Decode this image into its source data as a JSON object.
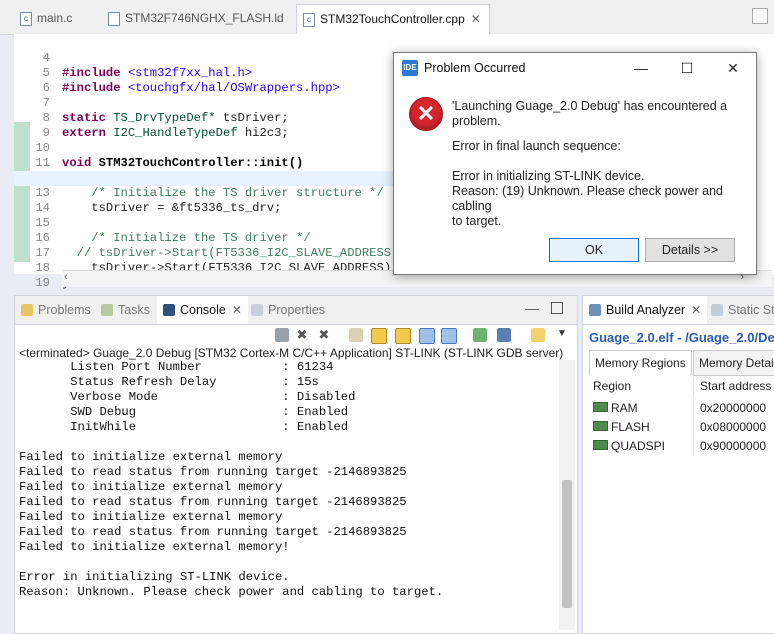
{
  "editor": {
    "tabs": [
      {
        "label": "main.c"
      },
      {
        "label": "STM32F746NGHX_FLASH.ld"
      },
      {
        "label": "STM32TouchController.cpp"
      }
    ],
    "lines": [
      {
        "n": "4"
      },
      {
        "n": "5"
      },
      {
        "n": "6"
      },
      {
        "n": "7"
      },
      {
        "n": "8"
      },
      {
        "n": "9"
      },
      {
        "n": "10"
      },
      {
        "n": "11"
      },
      {
        "n": "12"
      },
      {
        "n": "13"
      },
      {
        "n": "14"
      },
      {
        "n": "15"
      },
      {
        "n": "16"
      },
      {
        "n": "17"
      },
      {
        "n": "18"
      },
      {
        "n": "19"
      }
    ],
    "code": {
      "l4_kw": "#include",
      "l4_rest": " <stm32f7xx_hal.h>",
      "l5_kw": "#include",
      "l5_rest": " <touchgfx/hal/OSWrappers.hpp>",
      "l7_kw": "static",
      "l7_ty": " TS_DrvTypeDef*",
      "l7_rest": " tsDriver;",
      "l8_kw": "extern",
      "l8_ty": " I2C_HandleTypeDef",
      "l8_rest": " hi2c3;",
      "l10_kw": "void",
      "l10_fn": " STM32TouchController::init()",
      "l11": "{",
      "l12": "    /* Initialize the TS driver structure */",
      "l13_a": "    tsDriver = ",
      "l13_b": "&ft5336_ts_drv;",
      "l15": "    /* Initialize the TS driver */",
      "l16": "  // tsDriver->Start(FT5336_I2C_SLAVE_ADDRESS)",
      "l17_a": "    tsDriver->",
      "l17_b": "Start",
      "l17_c": "(FT5336_I2C_SLAVE_ADDRESS);",
      "l18": "}"
    }
  },
  "console": {
    "tabs": [
      {
        "label": "Problems"
      },
      {
        "label": "Tasks"
      },
      {
        "label": "Console"
      },
      {
        "label": "Properties"
      }
    ],
    "header": "<terminated> Guage_2.0 Debug [STM32 Cortex-M C/C++ Application] ST-LINK (ST-LINK GDB server)",
    "output": [
      "       Listen Port Number           : 61234",
      "       Status Refresh Delay         : 15s",
      "       Verbose Mode                 : Disabled",
      "       SWD Debug                    : Enabled",
      "       InitWhile                    : Enabled",
      "",
      "Failed to initialize external memory",
      "Failed to read status from running target -2146893825",
      "Failed to initialize external memory",
      "Failed to read status from running target -2146893825",
      "Failed to initialize external memory",
      "Failed to read status from running target -2146893825",
      "Failed to initialize external memory!",
      "",
      "Error in initializing ST-LINK device.",
      "Reason: Unknown. Please check power and cabling to target."
    ]
  },
  "build": {
    "tabs": [
      {
        "label": "Build Analyzer"
      },
      {
        "label": "Static Sta"
      }
    ],
    "title": "Guage_2.0.elf - /Guage_2.0/De",
    "subtabs": [
      {
        "label": "Memory Regions"
      },
      {
        "label": "Memory Detai"
      }
    ],
    "columns": {
      "region": "Region",
      "start": "Start address"
    },
    "regions": [
      {
        "name": "RAM",
        "start": "0x20000000"
      },
      {
        "name": "FLASH",
        "start": "0x08000000"
      },
      {
        "name": "QUADSPI",
        "start": "0x90000000"
      }
    ]
  },
  "dialog": {
    "icon_label": "IDE",
    "title": "Problem Occurred",
    "message_line1": "'Launching Guage_2.0 Debug' has encountered a",
    "message_line2": "problem.",
    "detail_line1": "Error in final launch sequence:",
    "detail_line2": "Error in initializing ST-LINK device.",
    "detail_line3": "Reason: (19) Unknown. Please check power and cabling",
    "detail_line4": "to target.",
    "ok_label": "OK",
    "details_label": "Details >>"
  },
  "colors": {
    "accent": "#2a5db0",
    "error": "#d8262e",
    "keyword": "#7f0055",
    "comment": "#3f7f5f"
  }
}
